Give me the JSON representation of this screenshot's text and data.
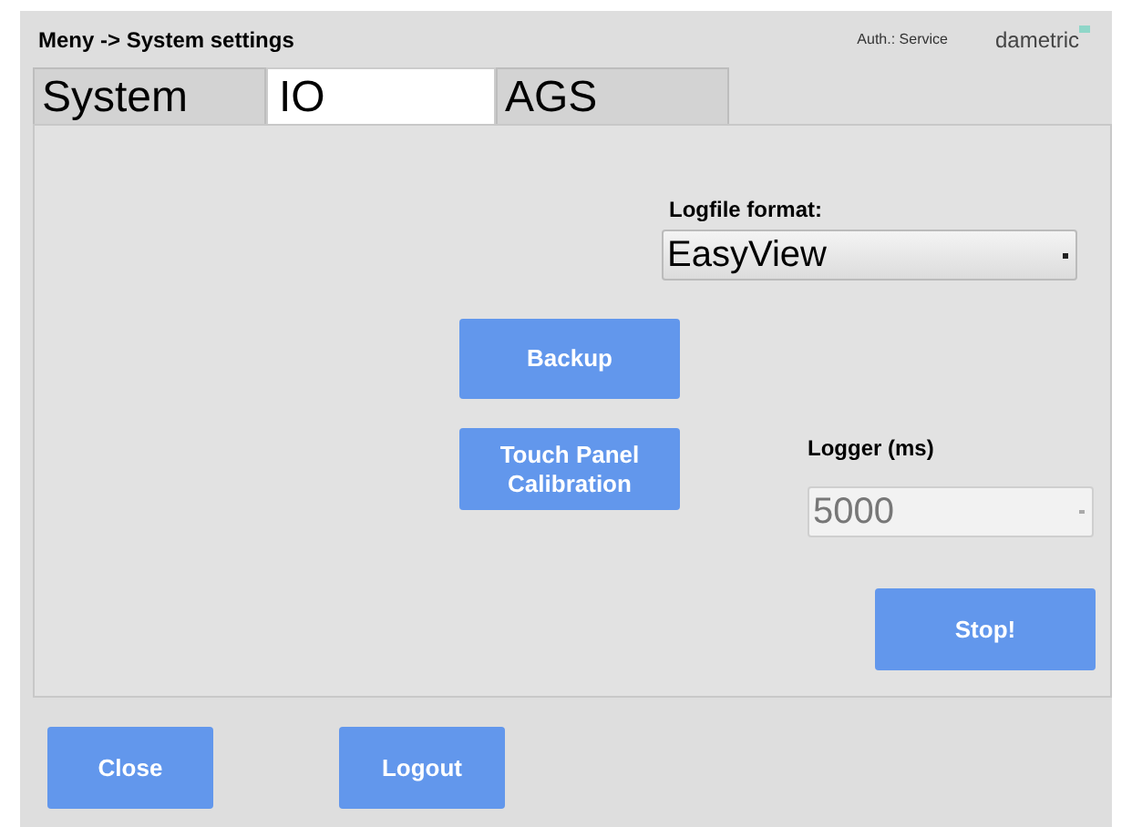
{
  "header": {
    "breadcrumb": "Meny -> System settings",
    "auth": "Auth.: Service",
    "logo": "dametric"
  },
  "tabs": [
    {
      "label": "System",
      "selected": false
    },
    {
      "label": "IO",
      "selected": true
    },
    {
      "label": "AGS",
      "selected": false
    }
  ],
  "logfile_format": {
    "label": "Logfile format:",
    "value": "EasyView",
    "disabled": false
  },
  "buttons": [
    {
      "label": "Backup"
    },
    {
      "label": "Touch Panel Calibration"
    }
  ],
  "logger": {
    "label": "Logger (ms)",
    "value": "5000",
    "disabled": true
  },
  "stop_button": {
    "label": "Stop!"
  },
  "footer_buttons": [
    {
      "label": "Close"
    },
    {
      "label": "Logout"
    }
  ]
}
